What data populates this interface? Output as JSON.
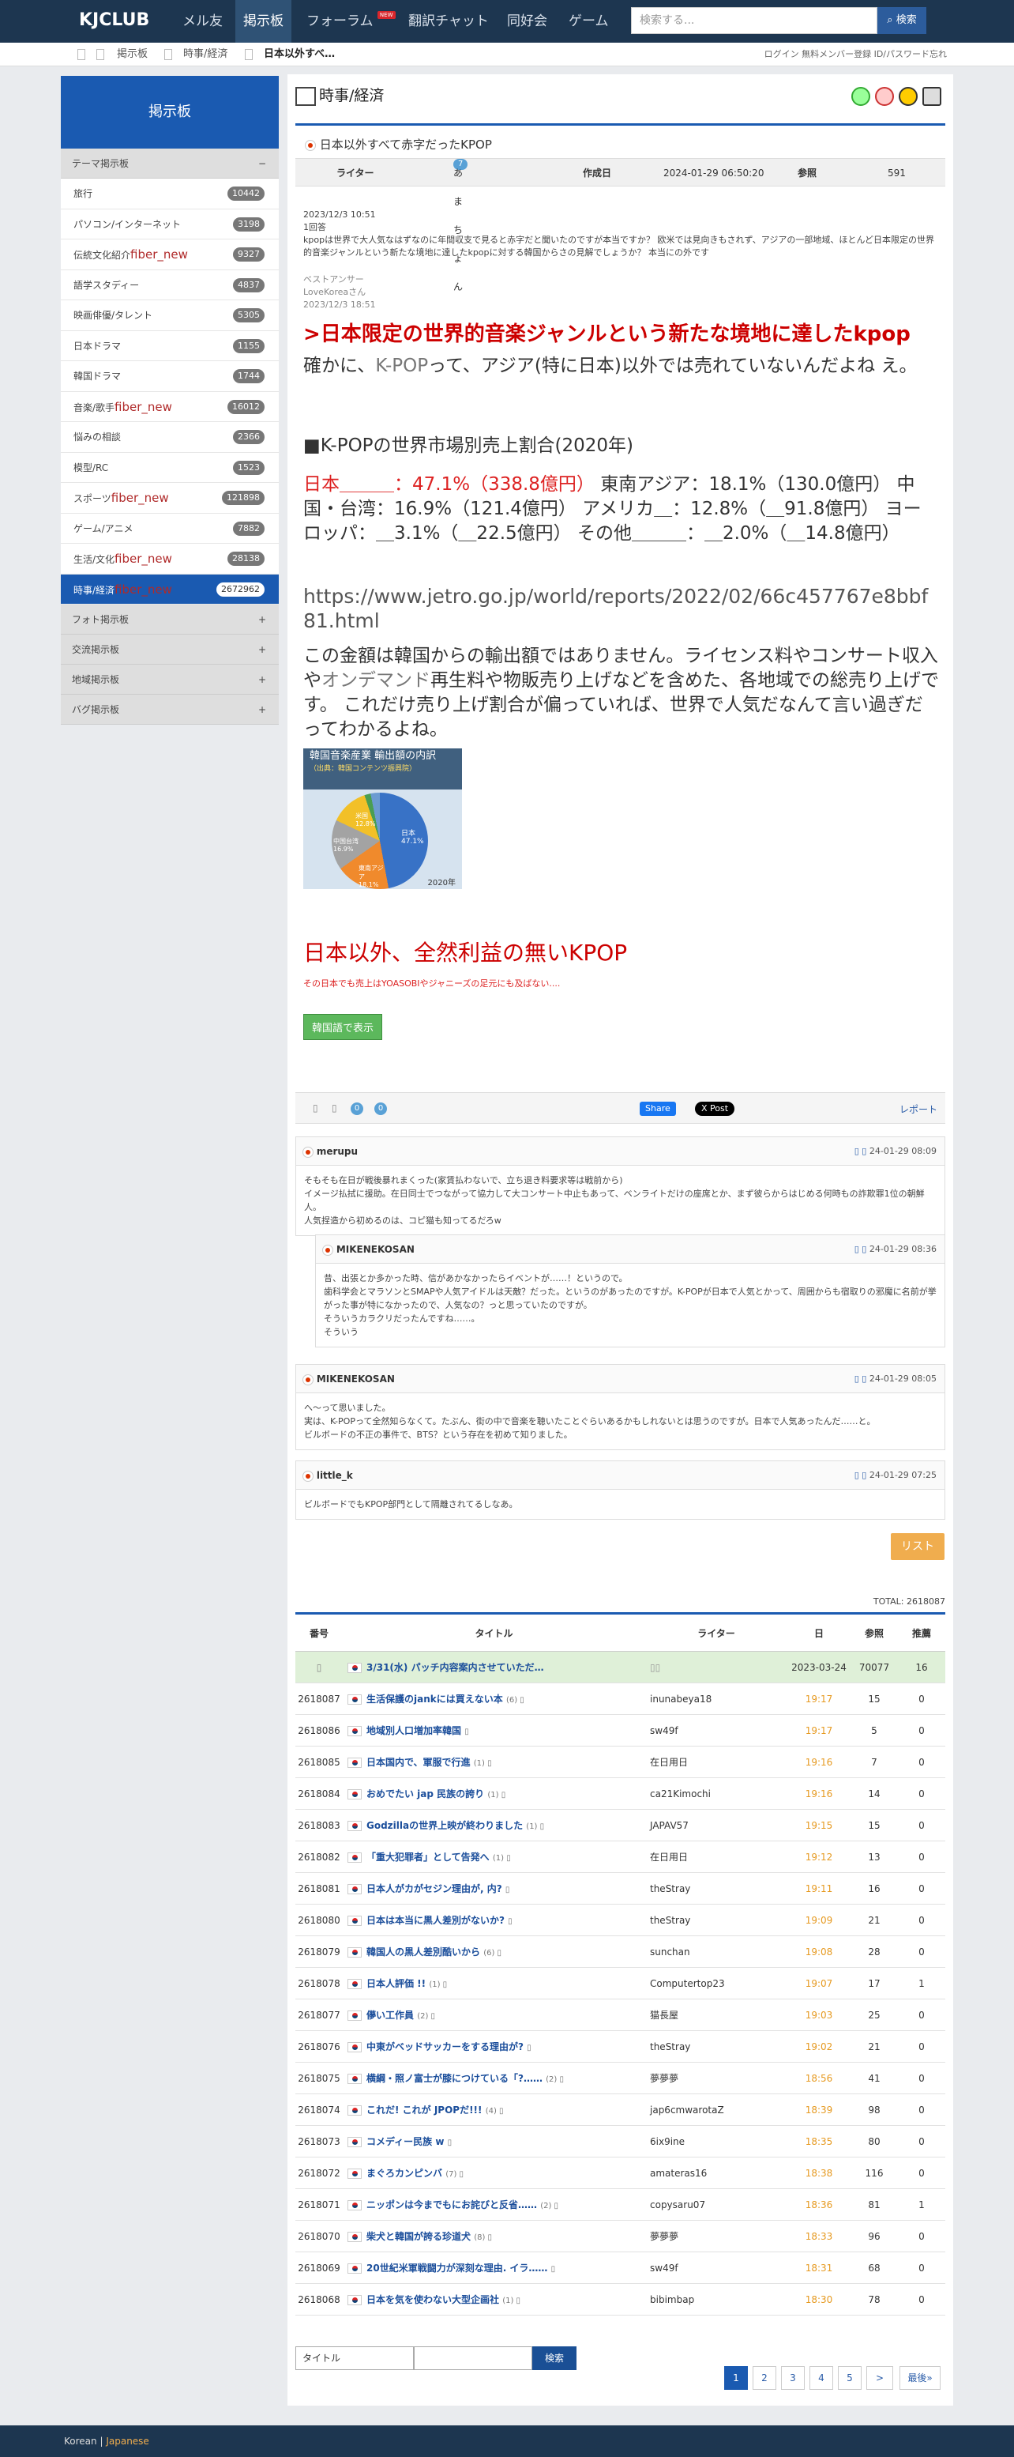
{
  "nav": {
    "logo": "KJCLUB",
    "items": [
      "メル友",
      "掲示板",
      "フォーラム",
      "翻訳チャット",
      "同好会",
      "ゲーム"
    ],
    "new_badge": "NEW",
    "search_placeholder": "検索する...",
    "search_btn": "検索"
  },
  "crumbs": [
    "掲示板",
    "時事/経済",
    "日本以外すべ…"
  ],
  "toplinks": "ログイン  無料メンバー登録  ID/パスワード忘れ",
  "sidebar": {
    "title": "掲示板",
    "group": "テーマ掲示板",
    "items": [
      {
        "label": "旅行",
        "count": "10442"
      },
      {
        "label": "パソコン/インターネット",
        "count": "3198"
      },
      {
        "label": "伝統文化紹介",
        "fn": "fiber_new",
        "count": "9327"
      },
      {
        "label": "語学スタディー",
        "count": "4837"
      },
      {
        "label": "映画俳優/タレント",
        "count": "5305"
      },
      {
        "label": "日本ドラマ",
        "count": "1155"
      },
      {
        "label": "韓国ドラマ",
        "count": "1744"
      },
      {
        "label": "音楽/歌手",
        "fn": "fiber_new",
        "count": "16012"
      },
      {
        "label": "悩みの相談",
        "count": "2366"
      },
      {
        "label": "模型/RC",
        "count": "1523"
      },
      {
        "label": "スポーツ",
        "fn": "fiber_new",
        "count": "121898"
      },
      {
        "label": "ゲーム/アニメ",
        "count": "7882"
      },
      {
        "label": "生活/文化",
        "fn": "fiber_new",
        "count": "28138"
      },
      {
        "label": "時事/経済",
        "fn": "fiber_new",
        "count": "2672962"
      }
    ],
    "groups2": [
      "フォト掲示板",
      "交流掲示板",
      "地域掲示板",
      "バグ掲示板"
    ]
  },
  "page": {
    "title": "時事/経済",
    "post_title": "日本以外すべて赤字だったKPOP"
  },
  "meta": {
    "writer_label": "ライター",
    "level": "7",
    "writer": "あまちょん",
    "date_label": "作成日",
    "date": "2024-01-29 06:50:20",
    "views_label": "参照",
    "views": "591"
  },
  "post": {
    "q_date": "2023/12/3 10:51",
    "answers": "1回答",
    "q_text": "kpopは世界で大人気なはずなのに年間収支で見ると赤字だと聞いたのですが本当ですか？ 欧米では見向きもされず、アジアの一部地域、ほとんど日本限定の世界的音楽ジャンルという新たな境地に達したkpopに対する韓国からさの見解でしょうか？ 本当にの外です",
    "ba": "ベストアンサー",
    "ba_user": "LoveKoreaさん",
    "ba_date": "2023/12/3 18:51",
    "h1": ">日本限定の世界的音楽ジャンルという新たな境地に達したkpop",
    "p1a": "確かに、",
    "p1b": "K-POP",
    "p1c": "って、アジア(特に日本)以外では売れていないんだよね え。",
    "h2": "■K-POPの世界市場別売上割合(2020年)",
    "p2red": "日本＿＿＿：47.1%（338.8億円）",
    "p2": " 東南アジア：18.1%（130.0億円） 中国・台湾：16.9%（121.4億円） アメリカ＿：12.8%（＿91.8億円） ヨーロッパ：＿3.1%（＿22.5億円） その他＿＿＿：＿2.0%（＿14.8億円）",
    "url": "https://www.jetro.go.jp/world/reports/2022/02/66c457767e8bbf81.html",
    "p3a": "この金額は韓国からの輸出額ではありません。ライセンス料やコンサート収入や",
    "p3b": "オンデマンド",
    "p3c": "再生料や物販売り上げなどを含めた、各地域での総売り上げです。 これだけ売り上げ割合が偏っていれば、世界で人気だなんて言い過ぎだってわかるよね。",
    "img_title": "韓国音楽産業 輸出額の内訳",
    "img_source": "（出典：韓国コンテンツ振興院）",
    "img_year": "2020年",
    "img_jp": "日本 47.1%",
    "img_sea": "東南アジア 18.1%",
    "img_cn": "中国台湾 16.9%",
    "img_us": "米国 12.8%",
    "h3": "日本以外、全然利益の無いKPOP",
    "note": "その日本でも売上はYOASOBIやジャニーズの足元にも及ばない....",
    "korbtn": "韓国語で表示"
  },
  "share": {
    "c1": "0",
    "c2": "0",
    "fb": "Share",
    "x": "X Post",
    "report": "レポート"
  },
  "comments": [
    {
      "user": "merupu",
      "date": "24-01-29 08:09",
      "text": "そもそも在日が戦後暴れまくった(家賃払わないで、立ち退き料要求等は戦前から)\nイメージ払拭に援助。在日同士でつながって協力して大コンサート中止もあって、ベンライトだけの座席とか、まず彼らからはじめる何時もの詐欺罪1位の朝鮮人。\n人気捏造から初めるのは、コピ猫も知ってるだろw"
    },
    {
      "user": "MIKENEKOSAN",
      "date": "24-01-29 08:36",
      "text": "昔、出張とか多かった時、信があかなかったらイベントが……！というので。\n歯科学会とマラソンとSMAPや人気アイドルは天敵？だった。というのがあったのですが。K-POPが日本で人気とかって、周囲からも宿取りの邪魔に名前が挙がった事が特になかったので、人気なの？っと思っていたのですが。\nそういうカラクリだったんですね……。\nそういう"
    },
    {
      "user": "MIKENEKOSAN",
      "date": "24-01-29 08:05",
      "text": "へ〜って思いました。\n実は、K-POPって全然知らなくて。たぶん、街の中で音楽を聴いたことぐらいあるかもしれないとは思うのですが。日本で人気あったんだ……と。\nビルボードの不正の事件で、BTS？という存在を初めて知りました。"
    },
    {
      "user": "little_k",
      "date": "24-01-29 07:25",
      "text": "ビルボードでもKPOP部門として隔離されてるしなあ。"
    }
  ],
  "list_btn": "リスト",
  "total": "TOTAL: 2618087",
  "table": {
    "headers": [
      "番号",
      "タイトル",
      "ライター",
      "日",
      "参照",
      "推薦"
    ],
    "notice": {
      "title": "3/31(水) パッチ内容案内させていただ…",
      "writer": "",
      "date": "2023-03-24",
      "views": "70077",
      "rec": "16"
    },
    "rows": [
      {
        "no": "2618087",
        "title": "生活保護のjankには買えない本",
        "c": "(6)",
        "writer": "inunabeya18",
        "time": "19:17",
        "views": "15",
        "rec": "0"
      },
      {
        "no": "2618086",
        "title": "地域別人口増加率韓国",
        "c": "",
        "writer": "sw49f",
        "time": "19:17",
        "views": "5",
        "rec": "0"
      },
      {
        "no": "2618085",
        "title": "日本国内で、軍服で行進",
        "c": "(1)",
        "writer": "在日用日",
        "time": "19:16",
        "views": "7",
        "rec": "0"
      },
      {
        "no": "2618084",
        "title": "おめでたい jap 民族の誇り",
        "c": "(1)",
        "writer": "ca21Kimochi",
        "time": "19:16",
        "views": "14",
        "rec": "0"
      },
      {
        "no": "2618083",
        "title": "Godzillaの世界上映が終わりました",
        "c": "(1)",
        "writer": "JAPAV57",
        "time": "19:15",
        "views": "15",
        "rec": "0"
      },
      {
        "no": "2618082",
        "title": "「重大犯罪者」として告発へ",
        "c": "(1)",
        "writer": "在日用日",
        "time": "19:12",
        "views": "13",
        "rec": "0"
      },
      {
        "no": "2618081",
        "title": "日本人がカがセジン理由が, 内?",
        "c": "",
        "writer": "theStray",
        "time": "19:11",
        "views": "16",
        "rec": "0"
      },
      {
        "no": "2618080",
        "title": "日本は本当に黒人差別がないか?",
        "c": "",
        "writer": "theStray",
        "time": "19:09",
        "views": "21",
        "rec": "0"
      },
      {
        "no": "2618079",
        "title": "韓国人の黒人差別酷いから",
        "c": "(6)",
        "writer": "sunchan",
        "time": "19:08",
        "views": "28",
        "rec": "0"
      },
      {
        "no": "2618078",
        "title": "日本人評価 !!",
        "c": "(1)",
        "writer": "Computertop23",
        "time": "19:07",
        "views": "17",
        "rec": "1"
      },
      {
        "no": "2618077",
        "title": "儚い工作員",
        "c": "(2)",
        "writer": "猫長屋",
        "time": "19:03",
        "views": "25",
        "rec": "0"
      },
      {
        "no": "2618076",
        "title": "中東がベッドサッカーをする理由が?",
        "c": "",
        "writer": "theStray",
        "time": "19:02",
        "views": "21",
        "rec": "0"
      },
      {
        "no": "2618075",
        "title": "横綱・照ノ富士が膝につけている「?……",
        "c": "(2)",
        "writer": "夢夢夢",
        "time": "18:56",
        "views": "41",
        "rec": "0"
      },
      {
        "no": "2618074",
        "title": "これだ! これが JPOPだ!!!",
        "c": "(4)",
        "writer": "jap6cmwarotaZ",
        "time": "18:39",
        "views": "98",
        "rec": "0"
      },
      {
        "no": "2618073",
        "title": "コメディー民族 w",
        "c": "",
        "writer": "6ix9ine",
        "time": "18:35",
        "views": "80",
        "rec": "0"
      },
      {
        "no": "2618072",
        "title": "まぐろカンピンバ",
        "c": "(7)",
        "writer": "amateras16",
        "time": "18:38",
        "views": "116",
        "rec": "0"
      },
      {
        "no": "2618071",
        "title": "ニッポンは今までもにお詫びと反省……",
        "c": "(2)",
        "writer": "copysaru07",
        "time": "18:36",
        "views": "81",
        "rec": "1"
      },
      {
        "no": "2618070",
        "title": "柴犬と韓国が誇る珍道犬",
        "c": "(8)",
        "writer": "夢夢夢",
        "time": "18:33",
        "views": "96",
        "rec": "0"
      },
      {
        "no": "2618069",
        "title": "20世紀米軍戦闘力が深刻な理由. イラ……",
        "c": "",
        "writer": "sw49f",
        "time": "18:31",
        "views": "68",
        "rec": "0"
      },
      {
        "no": "2618068",
        "title": "日本を気を使わない大型企画社",
        "c": "(1)",
        "writer": "bibimbap",
        "time": "18:30",
        "views": "78",
        "rec": "0"
      }
    ]
  },
  "search": {
    "select": "タイトル",
    "btn": "検索"
  },
  "pager": [
    "1",
    "2",
    "3",
    "4",
    "5",
    ">",
    "最後»"
  ],
  "footer": {
    "ko": "Korean",
    "sep": "|",
    "ja": "Japanese"
  }
}
